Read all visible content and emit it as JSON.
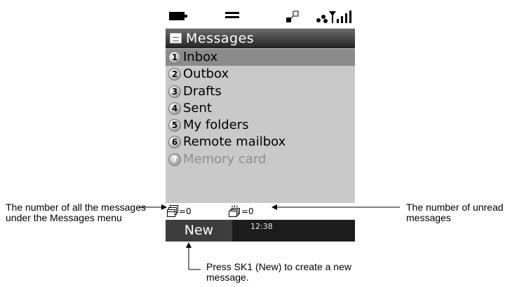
{
  "screen": {
    "title": "Messages",
    "menu": [
      {
        "num": "1",
        "label": "Inbox",
        "state": "selected"
      },
      {
        "num": "2",
        "label": "Outbox",
        "state": "normal"
      },
      {
        "num": "3",
        "label": "Drafts",
        "state": "normal"
      },
      {
        "num": "4",
        "label": "Sent",
        "state": "normal"
      },
      {
        "num": "5",
        "label": "My folders",
        "state": "normal"
      },
      {
        "num": "6",
        "label": "Remote mailbox",
        "state": "normal"
      },
      {
        "num": "7",
        "label": "Memory card",
        "state": "disabled"
      }
    ],
    "counts": {
      "all_messages": "=0",
      "unread_messages": "=0"
    },
    "softkeys": {
      "sk1_label": "New",
      "clock": "12:38"
    },
    "status_icons": [
      "battery-icon",
      "profile-icon",
      "network-icon",
      "signal-strength-icon"
    ],
    "colors": {
      "selected_row": "#8b8b8b",
      "list_background": "#c9c9c9",
      "disabled_text": "#8e8e8e",
      "softkey_bar": "#1c1c1c"
    }
  },
  "callouts": {
    "all_messages": "The number of all the messages under the Messages menu",
    "unread_messages": "The number of unread messages",
    "new_message": "Press SK1 (New) to create a new message."
  }
}
